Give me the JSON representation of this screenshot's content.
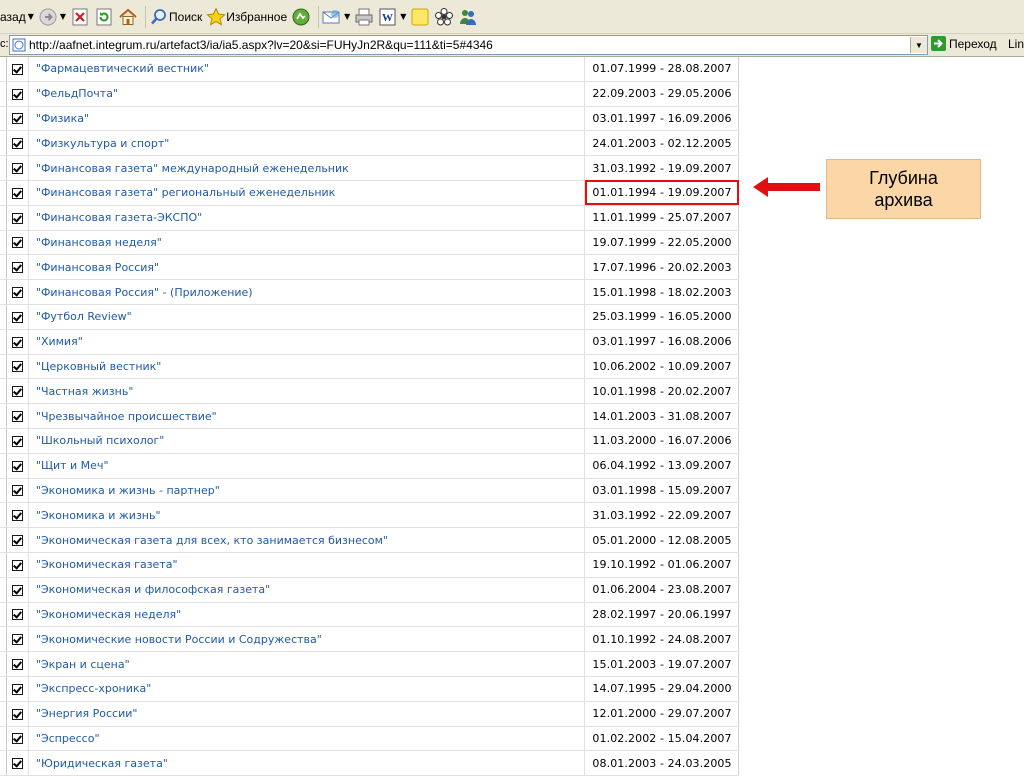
{
  "toolbar": {
    "back_label": "азад",
    "search_label": "Поиск",
    "favorites_label": "Избранное"
  },
  "address_bar": {
    "caption": "с:",
    "url": "http://aafnet.integrum.ru/artefact3/ia/ia5.aspx?lv=20&si=FUHyJn2R&qu=111&ti=5#4346",
    "go_label": "Переход",
    "links_label": "Lin"
  },
  "rows": [
    {
      "title": "\"Фармацевтический вестник\"",
      "range": "01.07.1999 - 28.08.2007"
    },
    {
      "title": "\"ФельдПочта\"",
      "range": "22.09.2003 - 29.05.2006"
    },
    {
      "title": "\"Физика\"",
      "range": "03.01.1997 - 16.09.2006"
    },
    {
      "title": "\"Физкультура и спорт\"",
      "range": "24.01.2003 - 02.12.2005"
    },
    {
      "title": "\"Финансовая газета\" международный еженедельник",
      "range": "31.03.1992 - 19.09.2007"
    },
    {
      "title": "\"Финансовая газета\" региональный еженедельник",
      "range": "01.01.1994 - 19.09.2007",
      "highlighted": true
    },
    {
      "title": "\"Финансовая газета-ЭКСПО\"",
      "range": "11.01.1999 - 25.07.2007"
    },
    {
      "title": "\"Финансовая неделя\"",
      "range": "19.07.1999 - 22.05.2000"
    },
    {
      "title": "\"Финансовая Россия\"",
      "range": "17.07.1996 - 20.02.2003"
    },
    {
      "title": "\"Финансовая Россия\" - (Приложение)",
      "range": "15.01.1998 - 18.02.2003"
    },
    {
      "title": "\"Футбол Review\"",
      "range": "25.03.1999 - 16.05.2000"
    },
    {
      "title": "\"Химия\"",
      "range": "03.01.1997 - 16.08.2006"
    },
    {
      "title": "\"Церковный вестник\"",
      "range": "10.06.2002 - 10.09.2007"
    },
    {
      "title": "\"Частная жизнь\"",
      "range": "10.01.1998 - 20.02.2007"
    },
    {
      "title": "\"Чрезвычайное происшествие\"",
      "range": "14.01.2003 - 31.08.2007"
    },
    {
      "title": "\"Школьный психолог\"",
      "range": "11.03.2000 - 16.07.2006"
    },
    {
      "title": "\"Щит и Меч\"",
      "range": "06.04.1992 - 13.09.2007"
    },
    {
      "title": "\"Экономика и жизнь - партнер\"",
      "range": "03.01.1998 - 15.09.2007"
    },
    {
      "title": "\"Экономика и жизнь\"",
      "range": "31.03.1992 - 22.09.2007"
    },
    {
      "title": "\"Экономическая газета для всех, кто занимается бизнесом\"",
      "range": "05.01.2000 - 12.08.2005"
    },
    {
      "title": "\"Экономическая газета\"",
      "range": "19.10.1992 - 01.06.2007"
    },
    {
      "title": "\"Экономическая и философская газета\"",
      "range": "01.06.2004 - 23.08.2007"
    },
    {
      "title": "\"Экономическая неделя\"",
      "range": "28.02.1997 - 20.06.1997"
    },
    {
      "title": "\"Экономические новости России и Содружества\"",
      "range": "01.10.1992 - 24.08.2007"
    },
    {
      "title": "\"Экран и сцена\"",
      "range": "15.01.2003 - 19.07.2007"
    },
    {
      "title": "\"Экспресс-хроника\"",
      "range": "14.07.1995 - 29.04.2000"
    },
    {
      "title": "\"Энергия России\"",
      "range": "12.01.2000 - 29.07.2007"
    },
    {
      "title": "\"Эспрессо\"",
      "range": "01.02.2002 - 15.04.2007"
    },
    {
      "title": "\"Юридическая газета\"",
      "range": "08.01.2003 - 24.03.2005"
    }
  ],
  "annotation": {
    "text_line1": "Глубина",
    "text_line2": "архива",
    "arrow_color": "#e01010",
    "box_color": "#fbd6a6"
  },
  "colors": {
    "link": "#1f5aa6",
    "highlight_border": "#e01010",
    "toolbar_bg": "#ece9d8"
  }
}
